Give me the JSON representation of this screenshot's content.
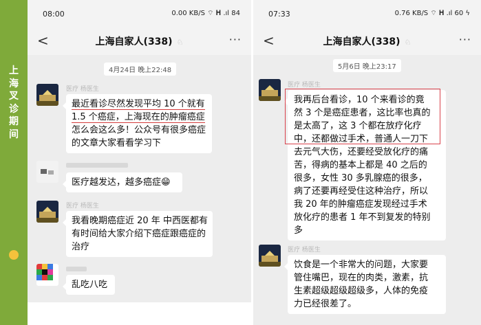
{
  "sidebar": {
    "title_chars": [
      "上",
      "海",
      "叉",
      "诊",
      "期",
      "间"
    ]
  },
  "left_phone": {
    "status": {
      "time": "08:00",
      "icons": "0.00 KB/S  ⌔ 𝐇 .ıl 84"
    },
    "nav": {
      "back": "<",
      "title": "上海自家人(338)",
      "mute": "♘",
      "more": "···"
    },
    "timestamp": "4月24日 晚上22:48",
    "messages": [
      {
        "sender": "医疗 杨医生",
        "lines": [
          "最近看诊尽然发现平均 10 个就有",
          "1.5 个癌症，上海现在的肿瘤癌症",
          "怎么会这么多！公众号有很多癌症",
          "的文章大家看看学习下"
        ]
      },
      {
        "sender": "",
        "lines": [
          "医疗越发达，越多癌症😁"
        ]
      },
      {
        "sender": "医疗 杨医生",
        "lines": [
          "我看晚期癌症近 20 年 中西医都有",
          "有时间给大家介绍下癌症跟癌症的",
          "治疗"
        ]
      },
      {
        "sender": "",
        "lines": [
          "乱吃八吃"
        ]
      }
    ]
  },
  "right_phone": {
    "status": {
      "time": "07:33",
      "icons": "0.76 KB/S  ⌔ 𝐇 .ıl 60 ϟ"
    },
    "nav": {
      "back": "<",
      "title": "上海自家人(338)",
      "mute": "♘",
      "more": "···"
    },
    "timestamp": "5月6日 晚上23:17",
    "messages": [
      {
        "sender": "医疗 杨医生",
        "lines": [
          "我再后台看诊，10 个来看诊的竟",
          "然 3 个是癌症患者，这比率也真的",
          "是太高了，这 3 个都在放疗化疗",
          "中，还都做过手术，普通人一刀下",
          "去元气大伤，还要经受放化疗的痛",
          "苦，得病的基本上都是 40 之后的",
          "很多，女性 30 多乳腺癌的很多，",
          "病了还要再经受住这种治疗，所以",
          "我 20 年的肿瘤癌症发现经过手术",
          "放化疗的患者 1 年不到复发的特别",
          "多"
        ]
      },
      {
        "sender": "医疗 杨医生",
        "lines": [
          "饮食是一个非常大的问题，大家要",
          "管住嘴巴，现在的肉类，激素，抗",
          "生素超级超级超级多，人体的免疫",
          "力已经很差了。"
        ]
      }
    ]
  },
  "colors": {
    "sidebar": "#7faa3a",
    "highlight": "#d9414b",
    "chat_bg": "#ededed"
  }
}
